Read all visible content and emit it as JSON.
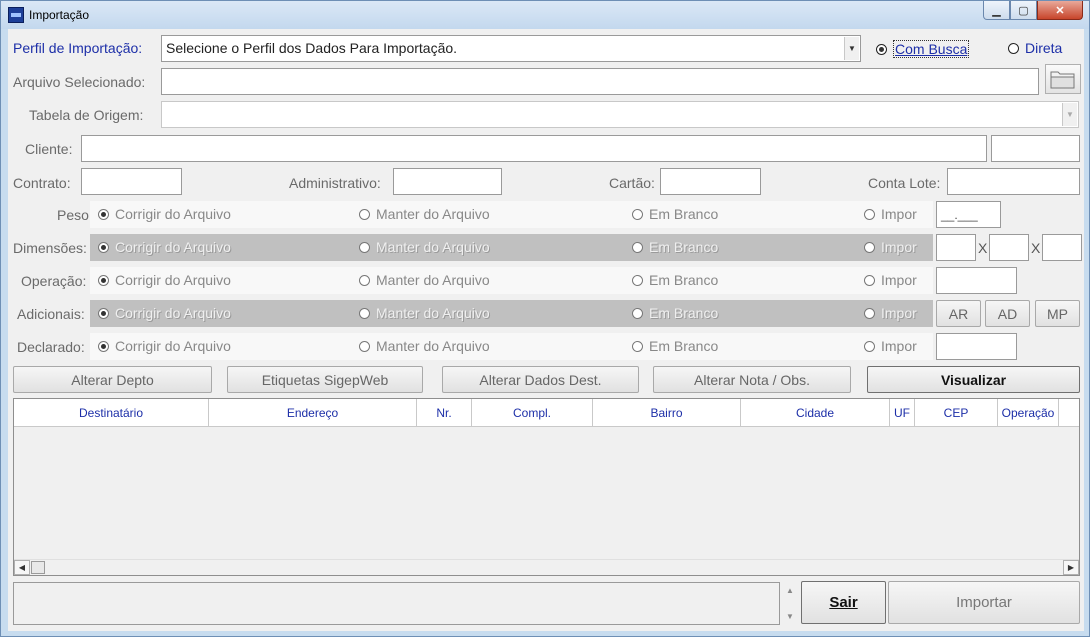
{
  "window": {
    "title": "Importação"
  },
  "perfil": {
    "label": "Perfil de Importação:",
    "value": "Selecione o Perfil dos Dados Para Importação.",
    "com_busca": "Com Busca",
    "direta": "Direta"
  },
  "arquivo": {
    "label": "Arquivo Selecionado:",
    "value": ""
  },
  "tabela": {
    "label": "Tabela de Origem:",
    "value": ""
  },
  "cliente": {
    "label": "Cliente:",
    "value": "",
    "code": ""
  },
  "contrato": {
    "label": "Contrato:",
    "value": ""
  },
  "administrativo": {
    "label": "Administrativo:",
    "value": ""
  },
  "cartao": {
    "label": "Cartão:",
    "value": ""
  },
  "conta_lote": {
    "label": "Conta Lote:",
    "value": ""
  },
  "options": {
    "corrigir": "Corrigir do Arquivo",
    "manter": "Manter do Arquivo",
    "branco": "Em Branco",
    "impor": "Impor"
  },
  "rows": {
    "peso": {
      "label": "Peso:",
      "value": "__.___"
    },
    "dimensoes": {
      "label": "Dimensões:",
      "sep": "X"
    },
    "operacao": {
      "label": "Operação:"
    },
    "adicionais": {
      "label": "Adicionais:",
      "ar": "AR",
      "ad": "AD",
      "mp": "MP"
    },
    "declarado": {
      "label": "Declarado:"
    }
  },
  "actions": {
    "alterar_depto": "Alterar Depto",
    "etiquetas": "Etiquetas SigepWeb",
    "alterar_dados": "Alterar Dados Dest.",
    "alterar_nota": "Alterar Nota / Obs.",
    "visualizar": "Visualizar"
  },
  "table": {
    "columns": [
      "Destinatário",
      "Endereço",
      "Nr.",
      "Compl.",
      "Bairro",
      "Cidade",
      "UF",
      "CEP",
      "Operação"
    ]
  },
  "footer": {
    "sair": "Sair",
    "importar": "Importar"
  }
}
